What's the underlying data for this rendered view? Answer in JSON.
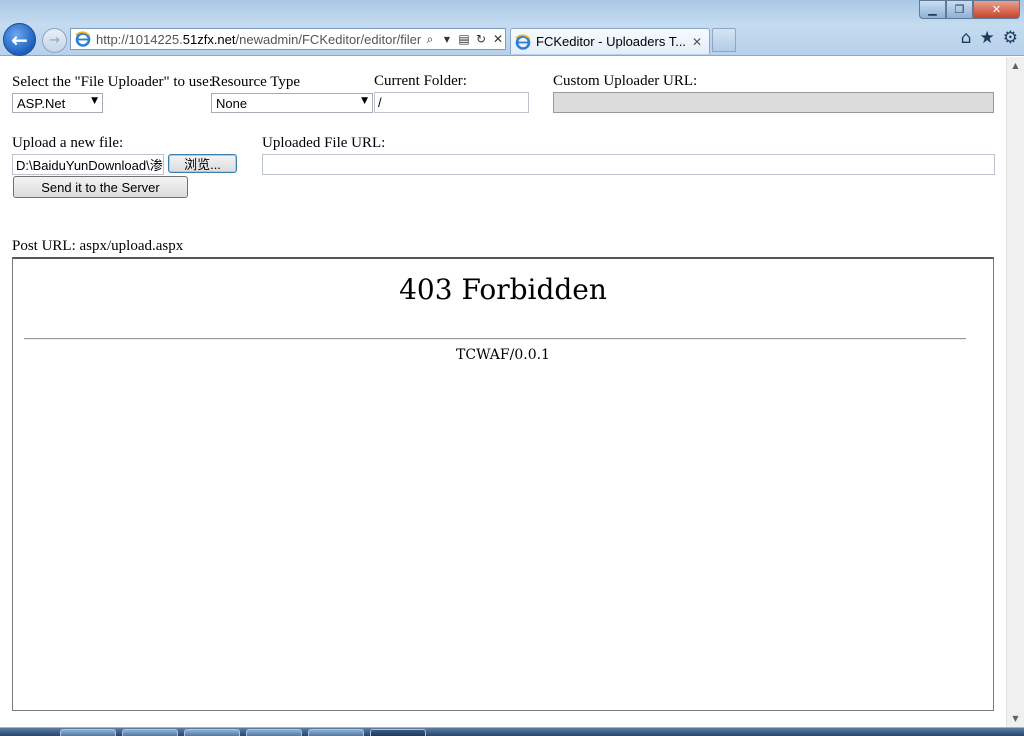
{
  "browser": {
    "address_scheme": "http://1014225.",
    "address_domain": "51zfx.net",
    "address_path": "/newadmin/FCKeditor/editor/filemanager/browser/default/frmupload.html",
    "tab_title": "FCKeditor - Uploaders T...",
    "tab_close": "✕",
    "icons": [
      "back-arrow-icon",
      "forward-arrow-icon",
      "ie-logo-icon",
      "search-icon",
      "compatibility-icon",
      "refresh-icon",
      "stop-icon",
      "home-icon",
      "favorites-star-icon",
      "tools-gear-icon"
    ]
  },
  "form": {
    "uploader_label": "Select the \"File Uploader\" to use:",
    "uploader_value": "ASP.Net",
    "resource_label": "Resource Type",
    "resource_value": "None",
    "folder_label": "Current Folder:",
    "folder_value": "/",
    "custom_url_label": "Custom Uploader URL:",
    "custom_url_value": "",
    "upload_label": "Upload a new file:",
    "file_path_value": "D:\\BaiduYunDownload\\渗透",
    "browse_label": "浏览...",
    "send_label": "Send it to the Server",
    "uploaded_url_label": "Uploaded File URL:",
    "uploaded_url_value": "",
    "post_url_label": "Post URL: aspx/upload.aspx"
  },
  "frame": {
    "title": "403 Forbidden",
    "server": "TCWAF/0.0.1"
  }
}
